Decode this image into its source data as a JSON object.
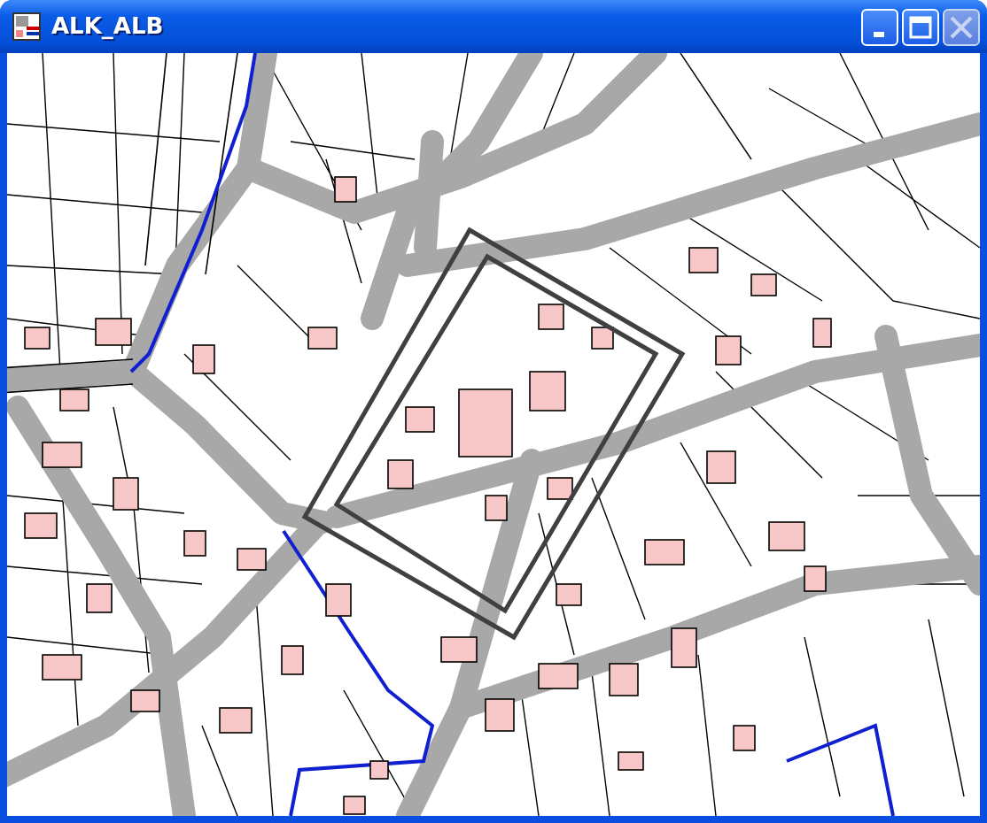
{
  "window": {
    "title": "ALK_ALB"
  }
}
